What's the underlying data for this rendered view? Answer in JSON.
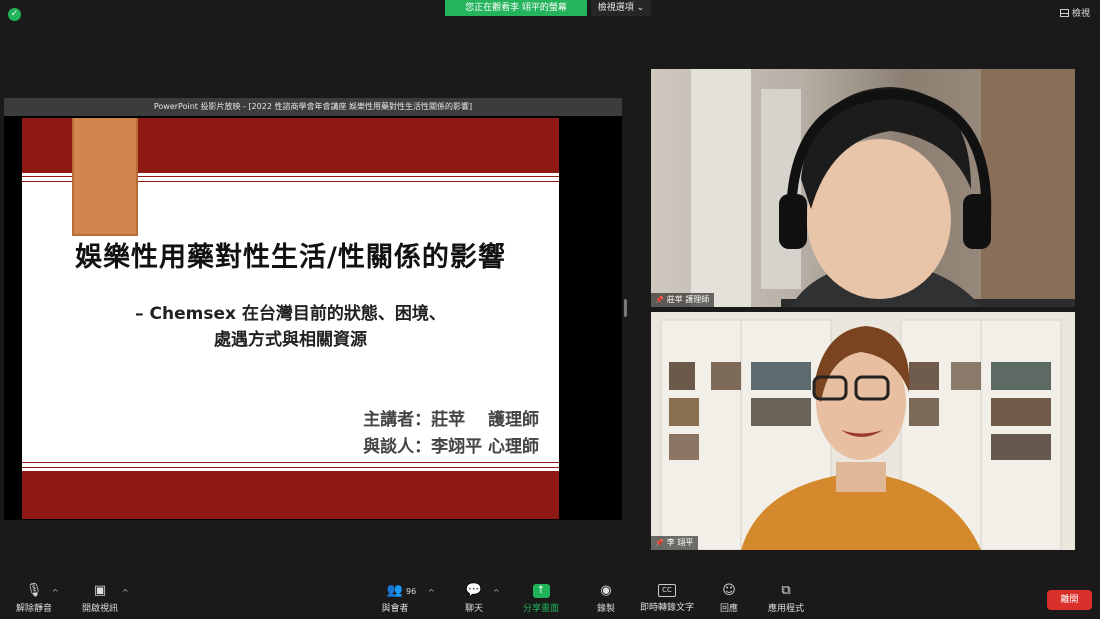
{
  "top_bar": {
    "viewing_banner": "您正在觀看李 翊平的螢幕",
    "view_options_label": "檢視選項",
    "view_label": "檢視"
  },
  "share": {
    "window_title": "PowerPoint 投影片放映 - [2022 性諮商學會年會講座  娛樂性用藥對性生活性關係的影響]",
    "slide": {
      "title": "娛樂性用藥對性生活/性關係的影響",
      "subtitle_line1": "– Chemsex 在台灣目前的狀態、困境、",
      "subtitle_line2": "處遇方式與相關資源",
      "speaker_line1": "主講者：莊苹　 護理師",
      "speaker_line2": "與談人：李翊平 心理師",
      "accent_color": "#8f1a15",
      "ribbon_color": "#d2864e"
    }
  },
  "participants": [
    {
      "name": "莊苹 護理師"
    },
    {
      "name": "李 翊平"
    }
  ],
  "toolbar": {
    "unmute": "解除靜音",
    "start_video": "開啟視訊",
    "participants": "與會者",
    "participant_count": "96",
    "chat": "聊天",
    "share_screen": "分享畫面",
    "record": "錄製",
    "live_transcript": "即時轉錄文字",
    "live_transcript_icon": "CC",
    "reactions": "回應",
    "apps": "應用程式",
    "leave": "離開"
  },
  "colors": {
    "share_green": "#20b35a",
    "leave_red": "#d9302c"
  }
}
